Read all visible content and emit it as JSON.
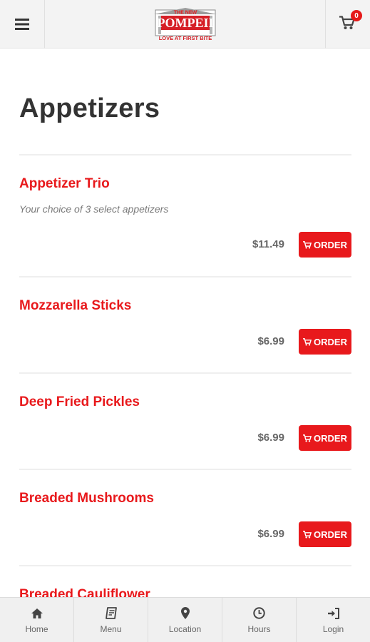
{
  "header": {
    "menu_icon": "hamburger-icon",
    "logo": {
      "top_text": "THE NEW",
      "main_text": "POMPEII",
      "tagline": "LOVE AT FIRST BITE"
    },
    "cart_icon": "cart-icon",
    "cart_count": "0"
  },
  "page_title": "Appetizers",
  "order_icon": "cart-icon",
  "items": [
    {
      "name": "Appetizer Trio",
      "description": "Your choice of 3 select appetizers",
      "price": "$11.49",
      "order_label": "ORDER"
    },
    {
      "name": "Mozzarella Sticks",
      "description": "",
      "price": "$6.99",
      "order_label": "ORDER"
    },
    {
      "name": "Deep Fried Pickles",
      "description": "",
      "price": "$6.99",
      "order_label": "ORDER"
    },
    {
      "name": "Breaded Mushrooms",
      "description": "",
      "price": "$6.99",
      "order_label": "ORDER"
    },
    {
      "name": "Breaded Cauliflower",
      "description": "",
      "price": "",
      "order_label": ""
    }
  ],
  "bottom_nav": [
    {
      "label": "Home",
      "icon": "home-icon"
    },
    {
      "label": "Menu",
      "icon": "book-icon"
    },
    {
      "label": "Location",
      "icon": "map-pin-icon"
    },
    {
      "label": "Hours",
      "icon": "clock-icon"
    },
    {
      "label": "Login",
      "icon": "login-icon"
    }
  ],
  "colors": {
    "accent": "#e8191c",
    "title": "#333333",
    "price": "#666666",
    "bar_bg": "#f3f3f3"
  }
}
